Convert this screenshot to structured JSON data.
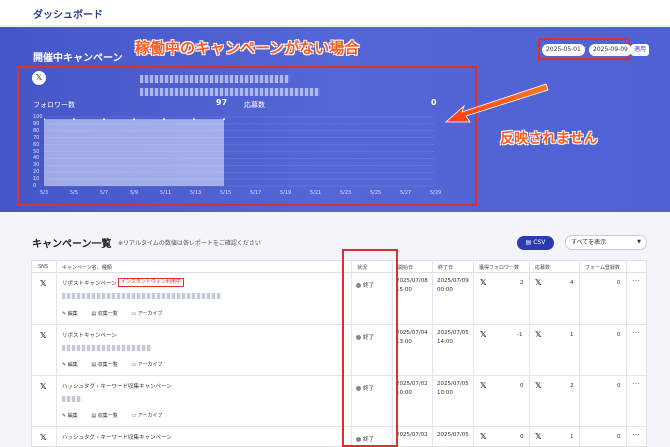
{
  "header": {
    "title": "ダッシュボード"
  },
  "hero": {
    "title": "開催中キャンペーン",
    "annotation_title": "稼働中のキャンペーンがない場合",
    "annotation_note": "反映されません",
    "follower_label": "フォロワー数",
    "follower_value": "97",
    "applicant_label": "応募数",
    "applicant_value": "0",
    "date_from": "2025-05-01",
    "date_sep": "-",
    "date_to": "2025-09-09",
    "apply_label": "適用",
    "y_ticks": [
      "100",
      "90",
      "80",
      "70",
      "60",
      "50",
      "40",
      "30",
      "20",
      "10",
      "0"
    ],
    "x_ticks": [
      "5/3",
      "5/5",
      "5/7",
      "5/9",
      "5/11",
      "5/13",
      "5/15",
      "5/17",
      "5/19",
      "5/21",
      "5/23",
      "5/25",
      "5/27",
      "5/29"
    ]
  },
  "chart_data": {
    "type": "area",
    "x": [
      "5/3",
      "5/5",
      "5/7",
      "5/9",
      "5/11",
      "5/13",
      "5/15",
      "5/17",
      "5/19",
      "5/21",
      "5/23",
      "5/25",
      "5/27",
      "5/29"
    ],
    "series": [
      {
        "values": [
          97,
          97,
          97,
          97,
          97,
          97,
          97,
          null,
          null,
          null,
          null,
          null,
          null,
          null
        ]
      }
    ],
    "ylim": [
      0,
      100
    ]
  },
  "section": {
    "title": "キャンペーン一覧",
    "note": "※リアルタイムの数値は各レポートをご確認ください",
    "csv_label": "CSV",
    "filter_label": "すべてを表示"
  },
  "table": {
    "headers": [
      "SNS",
      "キャンペーン名、種類",
      "状況",
      "開始日",
      "終了日",
      "獲得フォロワー数",
      "応募数",
      "フォーム登録数"
    ],
    "action_edit": "編集",
    "action_list": "収集一覧",
    "action_archive": "アーカイブ",
    "rows": [
      {
        "name": "リポストキャンペーン",
        "badge": "インスタントウィン利用中",
        "status": "終了",
        "start_date": "2025/07/08",
        "start_time": "15:00",
        "end_date": "2025/07/09",
        "end_time": "00:00",
        "followers": "2",
        "applicants": "4",
        "forms": "0"
      },
      {
        "name": "リポストキャンペーン",
        "badge": "",
        "status": "終了",
        "start_date": "2025/07/04",
        "start_time": "13:00",
        "end_date": "2025/07/05",
        "end_time": "14:00",
        "followers": "-1",
        "applicants": "1",
        "forms": "0"
      },
      {
        "name": "ハッシュタグ・キーワード収集キャンペーン",
        "badge": "",
        "status": "終了",
        "start_date": "2025/07/02",
        "start_time": "10:00",
        "end_date": "2025/07/05",
        "end_time": "10:00",
        "followers": "0",
        "applicants": "2",
        "forms": "0"
      },
      {
        "name": "ハッシュタグ・キーワード収集キャンペーン",
        "badge": "",
        "status": "終了",
        "start_date": "2025/07/02",
        "start_time": "",
        "end_date": "2025/07/05",
        "end_time": "",
        "followers": "0",
        "applicants": "1",
        "forms": "0"
      }
    ]
  },
  "colors": {
    "hero": "#4f62d3",
    "accent": "#2d3bb0",
    "annotation": "#ff5a1f",
    "highlight_box": "#d9322e"
  },
  "icons": {
    "sns": "x-logo-icon",
    "more": "ellipsis-icon"
  }
}
